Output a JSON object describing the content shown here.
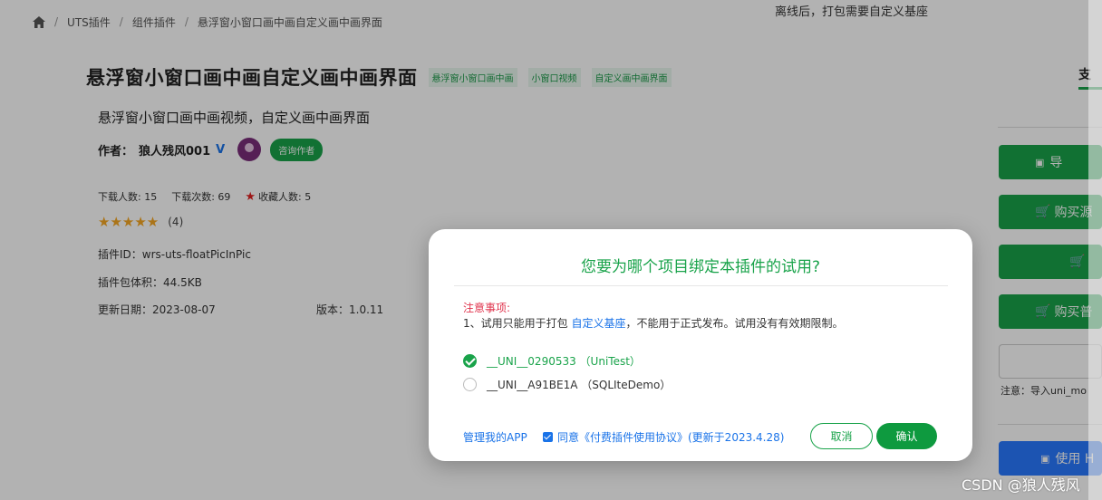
{
  "breadcrumb": {
    "items": [
      "UTS插件",
      "组件插件",
      "悬浮窗小窗口画中画自定义画中画界面"
    ]
  },
  "plugin": {
    "title": "悬浮窗小窗口画中画自定义画中画界面",
    "tags": [
      "悬浮窗小窗口画中画",
      "小窗口视频",
      "自定义画中画界面"
    ],
    "subtitle": "悬浮窗小窗口画中画视频，自定义画中画界面",
    "author_label": "作者：",
    "author_name": "狼人残风001",
    "verified_mark": "V",
    "contact_button": "咨询作者",
    "stats": {
      "downloaders": "下载人数: 15",
      "downloads": "下载次数: 69",
      "favorites": "收藏人数: 5"
    },
    "rating_stars": "★★★★★",
    "rating_count": "(4)",
    "plugin_id": "插件ID：wrs-uts-floatPicInPic",
    "package_size": "插件包体积：44.5KB",
    "updated": "更新日期：2023-08-07",
    "version": "版本：1.0.11"
  },
  "right_panel": {
    "top_text": "离线后，打包需要自定义基座",
    "tab_label": "支",
    "buttons": [
      "导",
      "购买源",
      "",
      "购买普"
    ],
    "note": "注意：导入uni_mo",
    "blue_button": "使用 H"
  },
  "modal": {
    "title": "您要为哪个项目绑定本插件的试用?",
    "notice_heading": "注意事项:",
    "notice_prefix": "1、试用只能用于打包 ",
    "notice_link": "自定义基座",
    "notice_suffix": "，不能用于正式发布。试用没有有效期限制。",
    "options": [
      {
        "label": "__UNI__0290533 （UniTest）",
        "selected": true
      },
      {
        "label": "__UNI__A91BE1A （SQLIteDemo）",
        "selected": false
      }
    ],
    "manage_link": "管理我的APP",
    "agree_text": "同意《付费插件使用协议》(更新于2023.4.28)",
    "agree_checked": true,
    "cancel_button": "取消",
    "confirm_button": "确认"
  },
  "watermark": "CSDN @狼人残风",
  "colors": {
    "primary_green": "#19a34a",
    "link_blue": "#1a73e8",
    "notice_red": "#e0344d",
    "overlay": "rgba(0,0,0,0.30)"
  }
}
